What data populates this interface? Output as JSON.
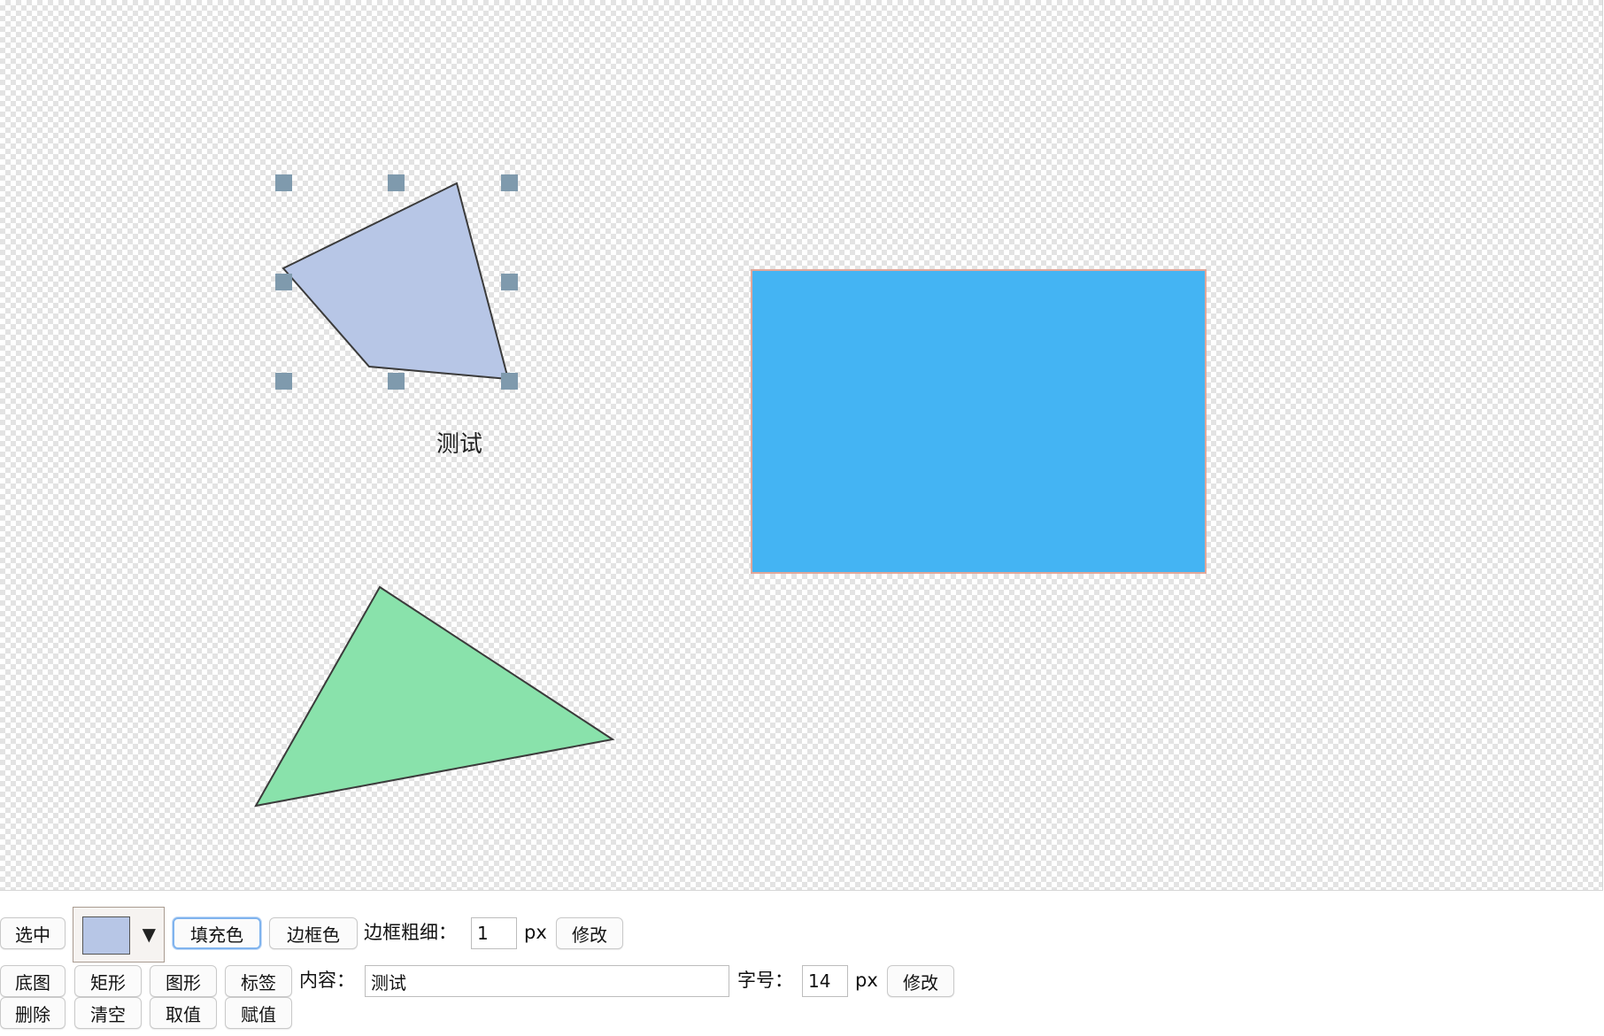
{
  "canvas": {
    "shape_label": "测试"
  },
  "shapes": {
    "polygon": {
      "fill": "#b7c6e6",
      "stroke": "#3b3b3b"
    },
    "rectangle": {
      "fill": "#44b4f3",
      "stroke": "#e0a79a"
    },
    "triangle": {
      "fill": "#89e2ab",
      "stroke": "#3b3b3b"
    },
    "handle_color": "#7f9aad"
  },
  "toolbar": {
    "row1": {
      "select_label": "选中",
      "color_picker": {
        "value": "#b7c6e6",
        "caret": "▼"
      },
      "fill_color_label": "填充色",
      "border_color_label": "边框色",
      "border_width_label": "边框粗细：",
      "border_width_value": "1",
      "border_width_unit": "px",
      "modify_label": "修改"
    },
    "row2": {
      "base_image_label": "底图",
      "rectangle_label": "矩形",
      "shape_label": "图形",
      "tag_label": "标签",
      "content_label": "内容：",
      "content_value": "测试",
      "font_size_label": "字号：",
      "font_size_value": "14",
      "font_size_unit": "px",
      "modify_label": "修改"
    },
    "row3": {
      "delete_label": "删除",
      "clear_label": "清空",
      "get_value_label": "取值",
      "set_value_label": "赋值"
    }
  }
}
